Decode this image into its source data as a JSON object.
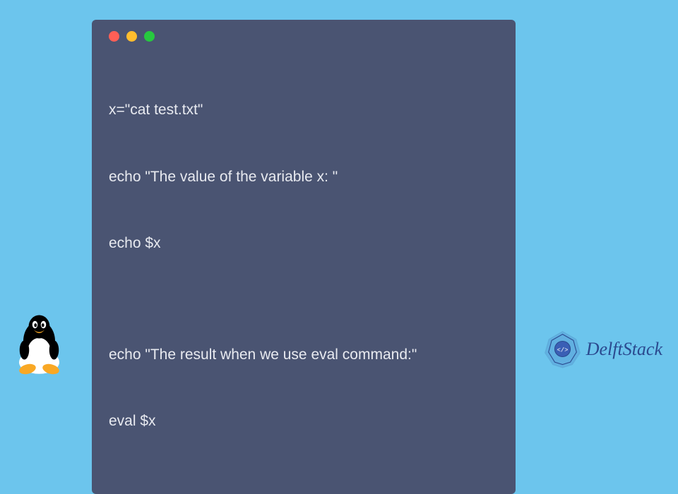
{
  "code": {
    "lines": [
      "x=\"cat test.txt\"",
      "echo \"The value of the variable x: \"",
      "echo $x",
      "",
      "echo \"The result when we use eval command:\"",
      "eval $x"
    ]
  },
  "brand": {
    "name": "DelftStack"
  }
}
